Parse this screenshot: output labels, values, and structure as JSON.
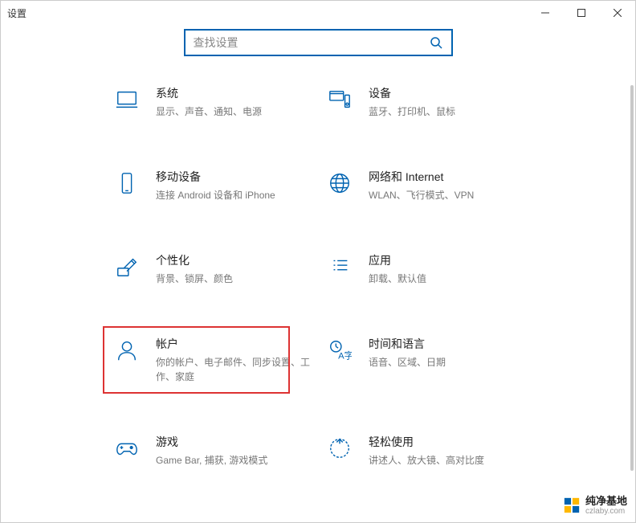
{
  "window": {
    "title": "设置"
  },
  "search": {
    "placeholder": "查找设置"
  },
  "tiles": {
    "system": {
      "title": "系统",
      "desc": "显示、声音、通知、电源"
    },
    "devices": {
      "title": "设备",
      "desc": "蓝牙、打印机、鼠标"
    },
    "phone": {
      "title": "移动设备",
      "desc": "连接 Android 设备和 iPhone"
    },
    "network": {
      "title": "网络和 Internet",
      "desc": "WLAN、飞行模式、VPN"
    },
    "personalize": {
      "title": "个性化",
      "desc": "背景、锁屏、颜色"
    },
    "apps": {
      "title": "应用",
      "desc": "卸载、默认值"
    },
    "accounts": {
      "title": "帐户",
      "desc": "你的帐户、电子邮件、同步设置、工作、家庭"
    },
    "time": {
      "title": "时间和语言",
      "desc": "语音、区域、日期"
    },
    "gaming": {
      "title": "游戏",
      "desc": "Game Bar, 捕获, 游戏模式"
    },
    "ease": {
      "title": "轻松使用",
      "desc": "讲述人、放大镜、高对比度"
    }
  },
  "watermark": {
    "name": "纯净基地",
    "url": "czlaby.com"
  }
}
